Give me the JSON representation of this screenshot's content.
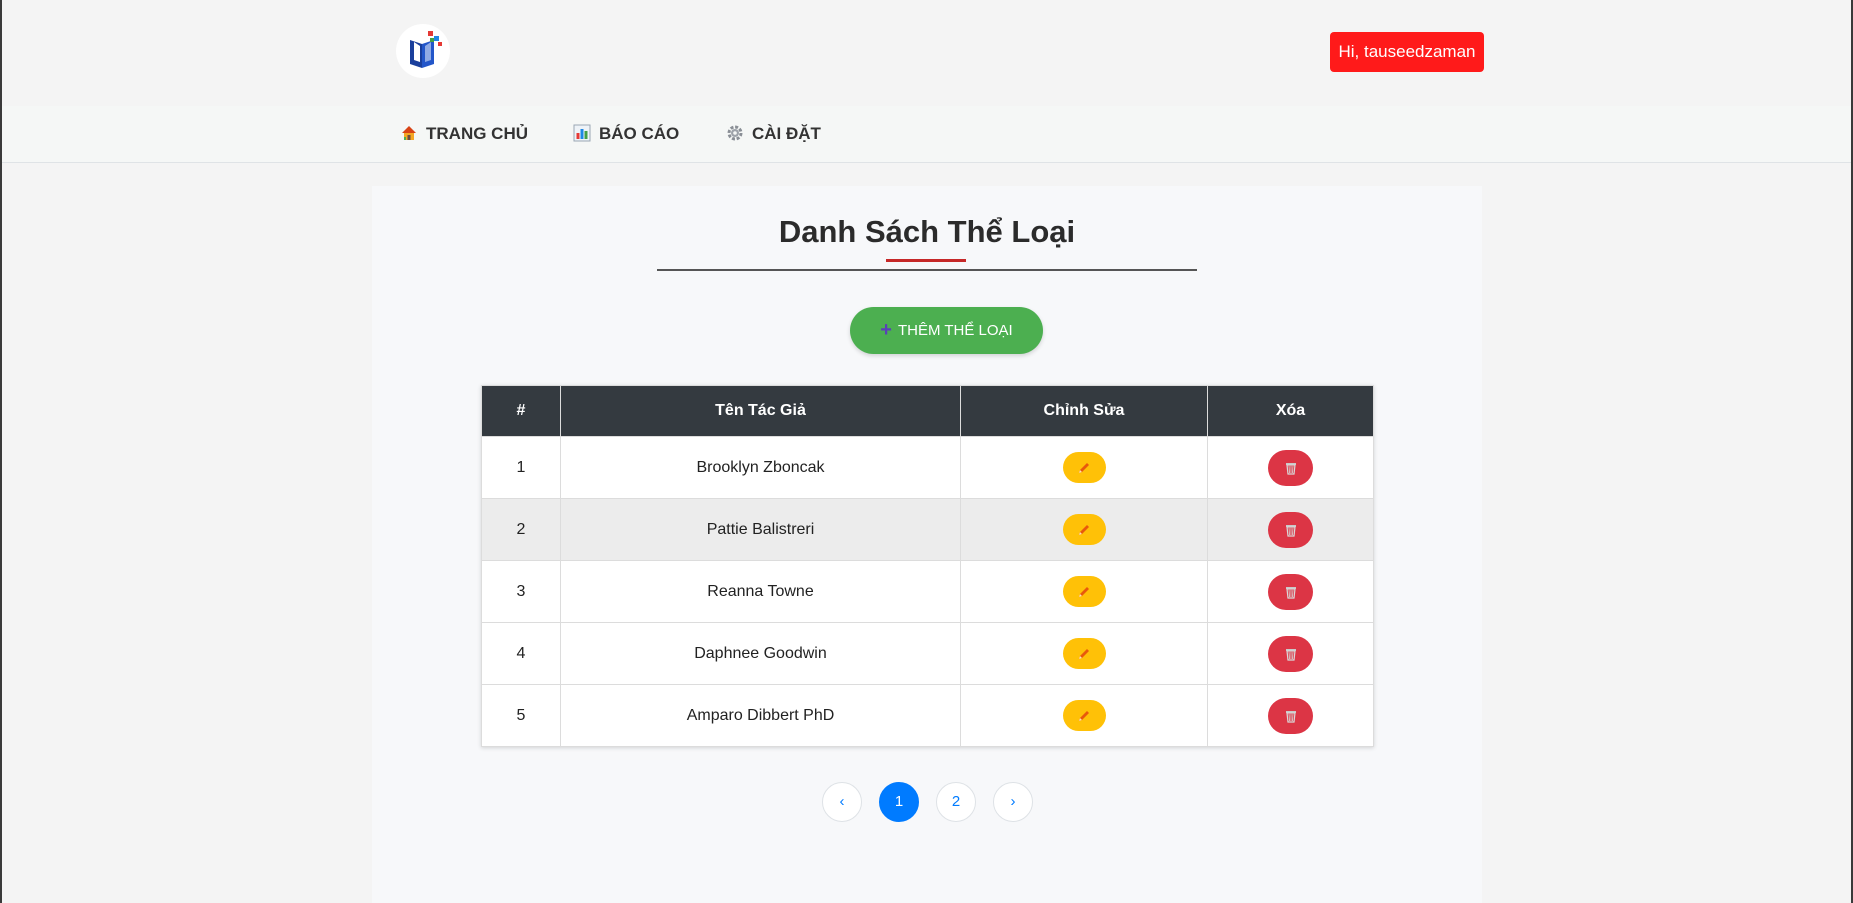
{
  "header": {
    "user_greeting": "Hi, tauseedzaman"
  },
  "nav": {
    "items": [
      {
        "label": "TRANG CHỦ",
        "icon": "home-icon"
      },
      {
        "label": "BÁO CÁO",
        "icon": "bar-chart-icon"
      },
      {
        "label": "CÀI ĐẶT",
        "icon": "gear-icon"
      }
    ]
  },
  "main": {
    "title": "Danh Sách Thể Loại",
    "add_button_label": "THÊM THỂ LOẠI",
    "table": {
      "headers": [
        "#",
        "Tên Tác Giả",
        "Chỉnh Sửa",
        "Xóa"
      ],
      "rows": [
        {
          "id": "1",
          "name": "Brooklyn Zboncak"
        },
        {
          "id": "2",
          "name": "Pattie Balistreri"
        },
        {
          "id": "3",
          "name": "Reanna Towne"
        },
        {
          "id": "4",
          "name": "Daphnee Goodwin"
        },
        {
          "id": "5",
          "name": "Amparo Dibbert PhD"
        }
      ]
    },
    "pagination": {
      "prev": "‹",
      "pages": [
        "1",
        "2"
      ],
      "next": "›",
      "current": "1"
    }
  },
  "colors": {
    "user_button": "#ff1a1a",
    "add_button": "#4caf50",
    "table_header": "#343a40",
    "edit_button": "#ffc107",
    "delete_button": "#dc3545",
    "pagination_active": "#007bff"
  }
}
